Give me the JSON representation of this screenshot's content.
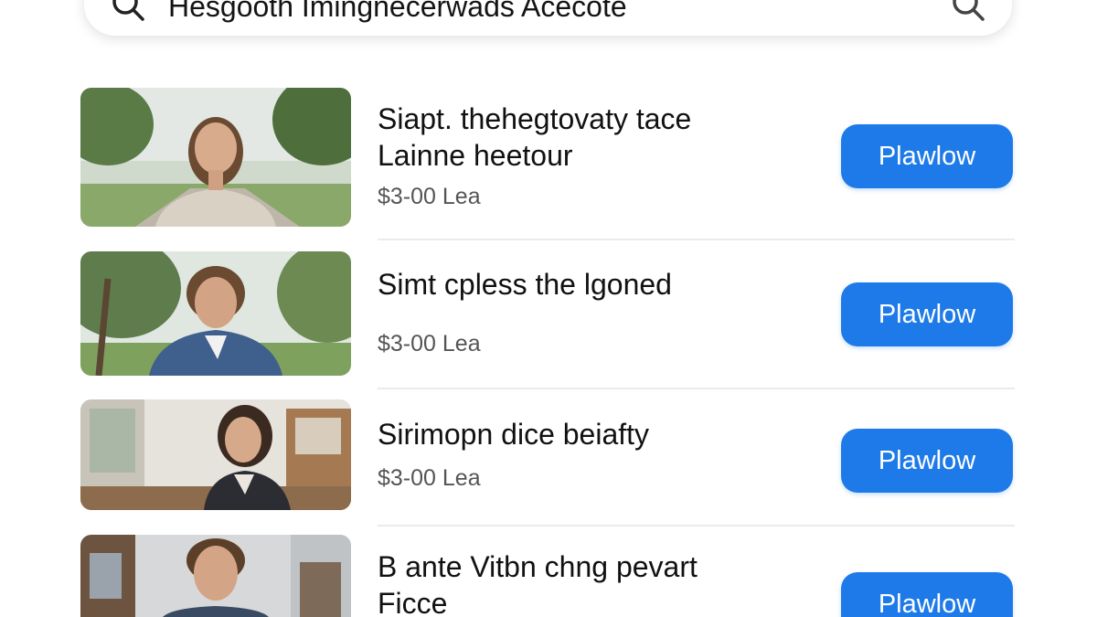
{
  "search": {
    "query": "Hesgooth Imingnecerwads Acecote",
    "search_icon": "search-icon",
    "filter_icon": "search-icon"
  },
  "colors": {
    "accent": "#1e7ae8",
    "price_text": "#555555",
    "divider": "#ebebeb"
  },
  "results": [
    {
      "title_line1": "Siapt. thehegtovaty tace",
      "title_line2": "Lainne heetour",
      "price": "$3-00 Lea",
      "button_label": "Plawlow"
    },
    {
      "title_line1": "Simt cpless the lgoned",
      "title_line2": "",
      "price": "$3-00 Lea",
      "button_label": "Plawlow"
    },
    {
      "title_line1": "Sirimopn dice beiafty",
      "title_line2": "",
      "price": "$3-00 Lea",
      "button_label": "Plawlow"
    },
    {
      "title_line1": "B ante Vitbn chng pevart",
      "title_line2": "Ficce",
      "price": "",
      "button_label": "Plawlow"
    }
  ]
}
